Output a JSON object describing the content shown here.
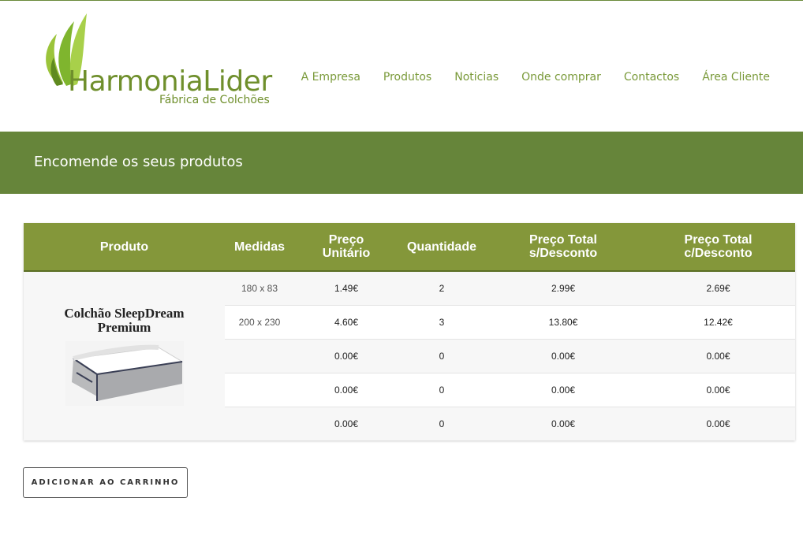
{
  "header": {
    "logo": {
      "name": "HarmoniaLider",
      "tagline": "Fábrica de Colchões"
    },
    "nav": [
      {
        "label": "A Empresa"
      },
      {
        "label": "Produtos"
      },
      {
        "label": "Noticias"
      },
      {
        "label": "Onde comprar"
      },
      {
        "label": "Contactos"
      },
      {
        "label": "Área Cliente"
      }
    ]
  },
  "banner": {
    "title": "Encomende os seus produtos"
  },
  "table": {
    "headers": {
      "produto": "Produto",
      "medidas": "Medidas",
      "preco_unit_1": "Preço",
      "preco_unit_2": "Unitário",
      "quantidade": "Quantidade",
      "total_sd_1": "Preço Total",
      "total_sd_2": "s/Desconto",
      "total_cd_1": "Preço Total",
      "total_cd_2": "c/Desconto"
    },
    "product": {
      "name": "Colchão SleepDream Premium",
      "image_icon": "mattress-image"
    },
    "rows": [
      {
        "medidas": "180 x 83",
        "preco": "1.49€",
        "quantidade": "2",
        "total_sd": "2.99€",
        "total_cd": "2.69€"
      },
      {
        "medidas": "200 x 230",
        "preco": "4.60€",
        "quantidade": "3",
        "total_sd": "13.80€",
        "total_cd": "12.42€"
      },
      {
        "medidas": "",
        "preco": "0.00€",
        "quantidade": "0",
        "total_sd": "0.00€",
        "total_cd": "0.00€"
      },
      {
        "medidas": "",
        "preco": "0.00€",
        "quantidade": "0",
        "total_sd": "0.00€",
        "total_cd": "0.00€"
      },
      {
        "medidas": "",
        "preco": "0.00€",
        "quantidade": "0",
        "total_sd": "0.00€",
        "total_cd": "0.00€"
      }
    ]
  },
  "actions": {
    "add_to_cart": "ADICIONAR AO CARRINHO"
  },
  "colors": {
    "brand_green": "#66853a",
    "header_green": "#84973a",
    "nav_text": "#7a9a3a"
  }
}
